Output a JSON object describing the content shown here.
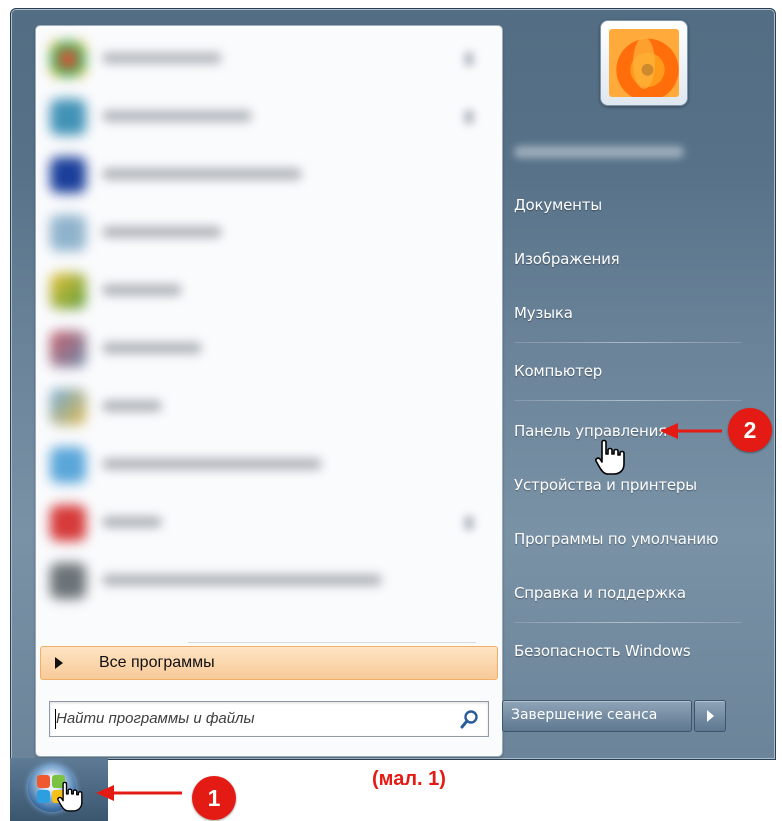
{
  "start_menu": {
    "all_programs_label": "Все программы",
    "search_placeholder": "Найти программы и файлы",
    "right_items": [
      "Документы",
      "Изображения",
      "Музыка",
      "Компьютер",
      "Панель управления",
      "Устройства и принтеры",
      "Программы по умолчанию",
      "Справка и поддержка",
      "Безопасность Windows"
    ],
    "shutdown_label": "Завершение сеанса"
  },
  "annotations": {
    "badge_1": "1",
    "badge_2": "2",
    "caption": "(мал. 1)"
  },
  "colors": {
    "annotation_red": "#e31b14",
    "all_programs_highlight": "#f8ca98",
    "menu_right_panel": "#6a8399"
  },
  "icons": {
    "start_orb": "windows-orb-icon",
    "search": "search-icon",
    "cursor": "hand-cursor-icon",
    "arrow": "red-arrow-icon",
    "avatar": "flower-avatar"
  }
}
